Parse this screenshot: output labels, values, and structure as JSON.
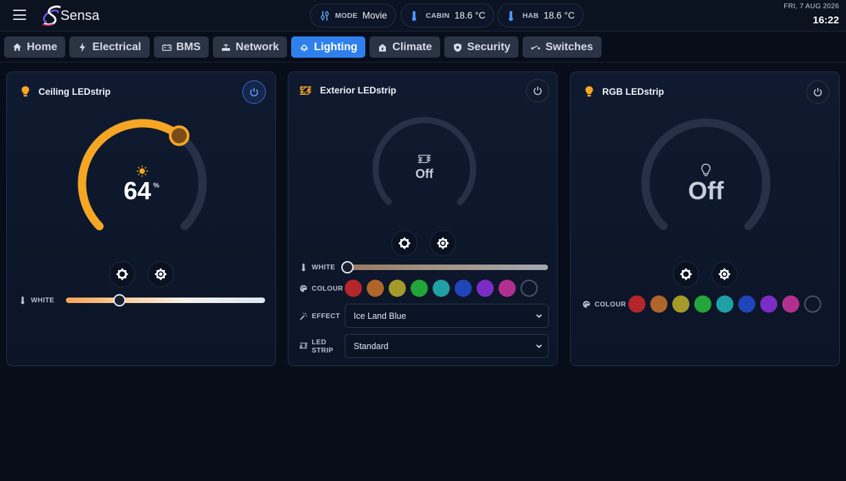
{
  "header": {
    "brand": "Sensa",
    "status": [
      {
        "label": "MODE",
        "value": "Movie",
        "icon": "sliders-icon"
      },
      {
        "label": "CABIN",
        "value": "18.6 °C",
        "icon": "thermometer-icon"
      },
      {
        "label": "HAB",
        "value": "18.6 °C",
        "icon": "thermometer-icon"
      }
    ],
    "date": "FRI, 7 AUG 2026",
    "time": "16:22"
  },
  "tabs": [
    {
      "label": "Home",
      "icon": "home-icon",
      "active": false
    },
    {
      "label": "Electrical",
      "icon": "bolt-icon",
      "active": false
    },
    {
      "label": "BMS",
      "icon": "battery-icon",
      "active": false
    },
    {
      "label": "Network",
      "icon": "router-icon",
      "active": false
    },
    {
      "label": "Lighting",
      "icon": "bulb-icon",
      "active": true
    },
    {
      "label": "Climate",
      "icon": "climate-icon",
      "active": false
    },
    {
      "label": "Security",
      "icon": "shield-icon",
      "active": false
    },
    {
      "label": "Switches",
      "icon": "switch-icon",
      "active": false
    }
  ],
  "colors": {
    "accent": "#2f80ed",
    "amber": "#f5a623",
    "swatches": [
      "#b3262a",
      "#b0652a",
      "#a39a2a",
      "#22a63a",
      "#1ea0a4",
      "#1f45b8",
      "#7a2cc4",
      "#b1308f",
      "none"
    ]
  },
  "cards": [
    {
      "title": "Ceiling LEDstrip",
      "icon": "bulb-icon",
      "power": "on",
      "brightness": 64,
      "unit": "%",
      "white_label": "WHITE",
      "white_level": 0.27
    },
    {
      "title": "Exterior LEDstrip",
      "icon": "ledstrip-icon",
      "power": "off",
      "state": "Off",
      "white_label": "WHITE",
      "white_level": 0.0,
      "colour_label": "COLOUR",
      "effect_label": "EFFECT",
      "effect_value": "Ice Land Blue",
      "strip_label_1": "LED",
      "strip_label_2": "STRIP",
      "strip_value": "Standard"
    },
    {
      "title": "RGB LEDstrip",
      "icon": "bulb-icon",
      "power": "off",
      "state": "Off",
      "colour_label": "COLOUR"
    }
  ]
}
